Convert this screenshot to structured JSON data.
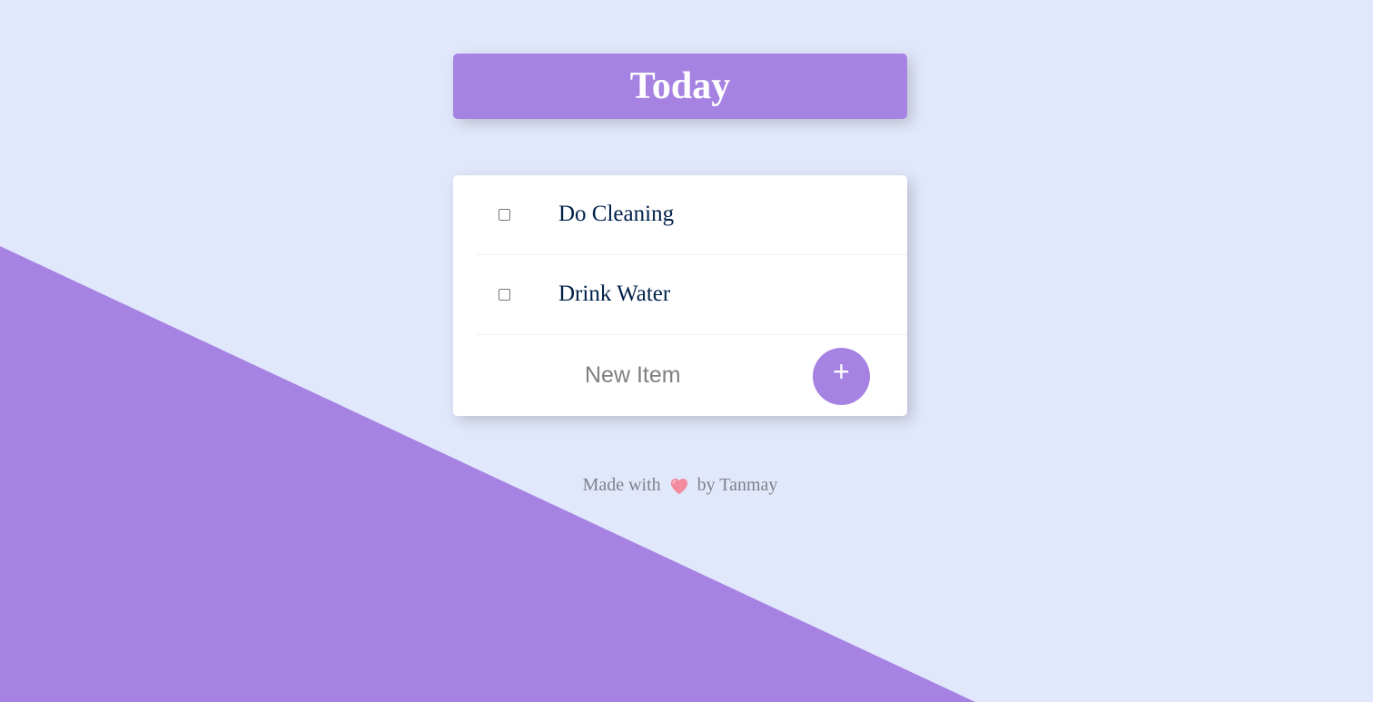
{
  "header": {
    "title": "Today"
  },
  "list": {
    "items": [
      {
        "label": "Do Cleaning",
        "checked": false
      },
      {
        "label": "Drink Water",
        "checked": false
      }
    ]
  },
  "new_item": {
    "placeholder": "New Item",
    "value": "",
    "add_label": "+"
  },
  "footer": {
    "prefix": "Made with",
    "icon": "heart-icon",
    "suffix": "by Tanmay"
  },
  "colors": {
    "background": "#E2E8FC",
    "accent": "#A683E3",
    "text": "#00204A",
    "heart": "#F28B9B"
  }
}
